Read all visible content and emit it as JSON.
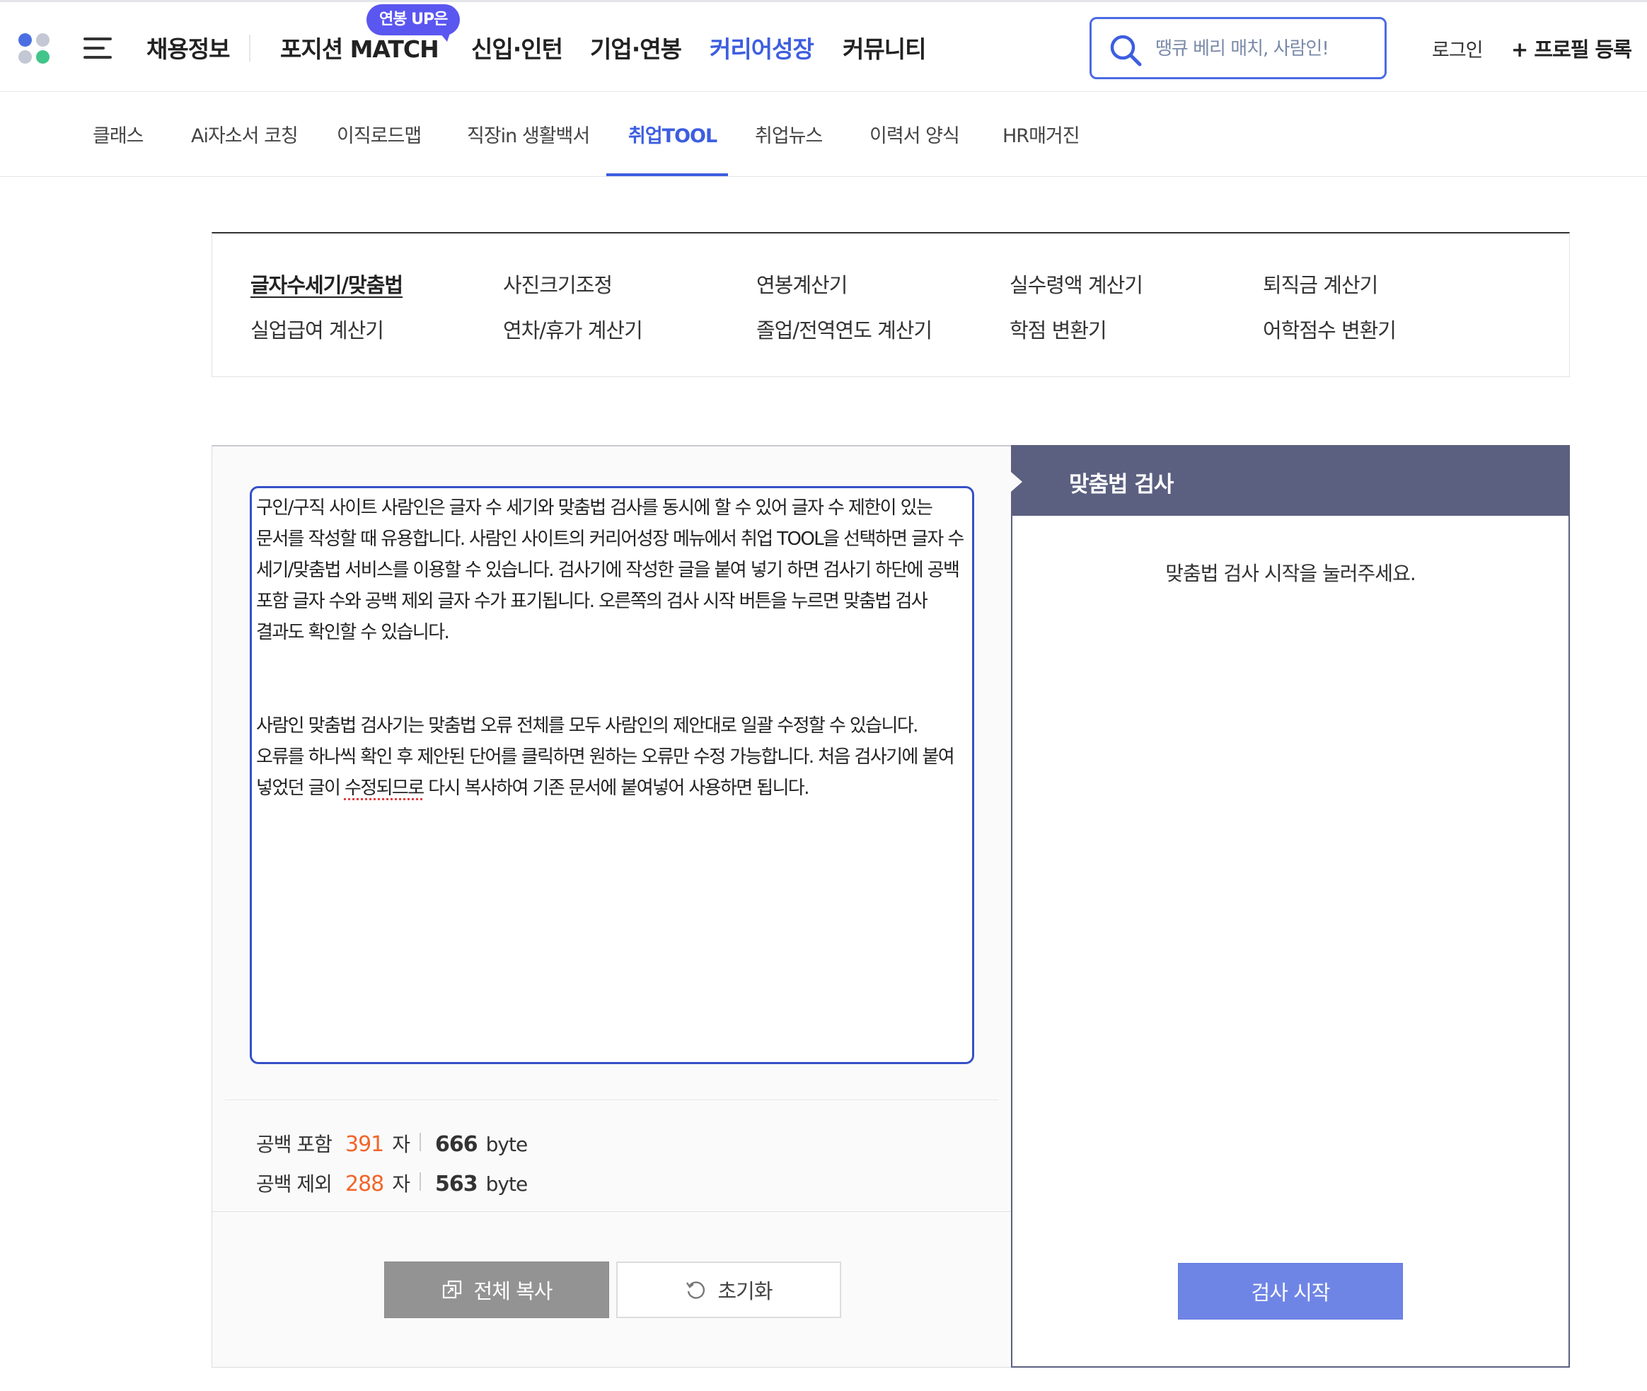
{
  "gnb": {
    "items": [
      {
        "label": "채용정보"
      },
      {
        "label": "포지션 MATCH"
      },
      {
        "label": "신입·인턴"
      },
      {
        "label": "기업·연봉"
      },
      {
        "label": "커리어성장"
      },
      {
        "label": "커뮤니티"
      }
    ],
    "match_badge": "연봉 UP은",
    "search_placeholder": "땡큐 베리 매치, 사람인!",
    "login": "로그인",
    "profile": "+ 프로필 등록",
    "colors": {
      "accent": "#3d5ee0",
      "badge": "#5a56f0"
    },
    "icons": [
      "logo-icon",
      "hamburger-menu-icon",
      "search-icon"
    ]
  },
  "subnav": {
    "items": [
      {
        "label": "클래스"
      },
      {
        "label": "Ai자소서 코칭"
      },
      {
        "label": "이직로드맵"
      },
      {
        "label": "직장in 생활백서"
      },
      {
        "label": "취업TOOL",
        "active": true
      },
      {
        "label": "취업뉴스"
      },
      {
        "label": "이력서 양식"
      },
      {
        "label": "HR매거진"
      }
    ]
  },
  "tools": {
    "items": [
      {
        "label": "글자수세기/맞춤법",
        "active": true
      },
      {
        "label": "사진크기조정"
      },
      {
        "label": "연봉계산기"
      },
      {
        "label": "실수령액 계산기"
      },
      {
        "label": "퇴직금 계산기"
      },
      {
        "label": "실업급여 계산기"
      },
      {
        "label": "연차/휴가 계산기"
      },
      {
        "label": "졸업/전역연도 계산기"
      },
      {
        "label": "학점 변환기"
      },
      {
        "label": "어학점수 변환기"
      }
    ]
  },
  "editor": {
    "paragraph1": "구인/구직 사이트 사람인은 글자 수 세기와 맞춤법 검사를 동시에 할 수 있어 글자 수 제한이 있는 문서를 작성할 때 유용합니다. 사람인 사이트의 커리어성장 메뉴에서 취업 TOOL을 선택하면 글자 수 세기/맞춤법 서비스를 이용할 수 있습니다. 검사기에 작성한 글을 붙여 넣기 하면 검사기 하단에 공백 포함 글자 수와 공백 제외 글자 수가 표기됩니다. 오른쪽의 검사 시작 버튼을 누르면 맞춤법 검사 결과도 확인할 수 있습니다.",
    "paragraph2_before": "사람인 맞춤법 검사기는 맞춤법 오류 전체를 모두 사람인의 제안대로 일괄 수정할 수 있습니다. 오류를 하나씩 확인 후 제안된 단어를 클릭하면 원하는 오류만 수정 가능합니다. 처음 검사기에 붙여 넣었던 글이 ",
    "paragraph2_error": "수정되므로",
    "paragraph2_after": " 다시 복사하여 기존 문서에 붙여넣어 사용하면 됩니다.",
    "count_with_space": {
      "label": "공백 포함",
      "chars": "391",
      "unit": "자",
      "bytes": "666",
      "bytes_unit": "byte"
    },
    "count_without_space": {
      "label": "공백 제외",
      "chars": "288",
      "unit": "자",
      "bytes": "563",
      "bytes_unit": "byte"
    },
    "copy_button": "전체 복사",
    "reset_button": "초기화",
    "colors": {
      "count_highlight": "#f2652a",
      "editor_border": "#3650c8"
    },
    "icons": [
      "copy-icon",
      "reset-icon"
    ]
  },
  "result": {
    "title": "맞춤법 검사",
    "message": "맞춤법 검사 시작을 눌러주세요.",
    "check_button": "검사 시작",
    "colors": {
      "header_bg": "#5b6080",
      "button_bg": "#6f85e6"
    }
  }
}
